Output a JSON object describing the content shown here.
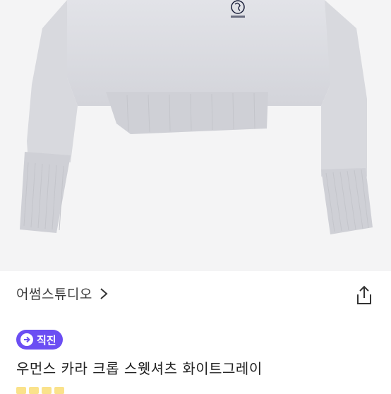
{
  "product_image": {
    "alt": "크롭 스웻셔츠 상품 이미지",
    "garment_color": "#d9dadf"
  },
  "brand": {
    "name": "어썸스튜디오",
    "chevron_icon": "chevron-right-icon"
  },
  "actions": {
    "share_icon": "share-icon"
  },
  "badge": {
    "label": "직진",
    "icon": "arrow-right-circle-icon",
    "color": "#6b4ef3"
  },
  "product": {
    "title": "우먼스 카라 크롭 스웻셔츠 화이트그레이"
  }
}
